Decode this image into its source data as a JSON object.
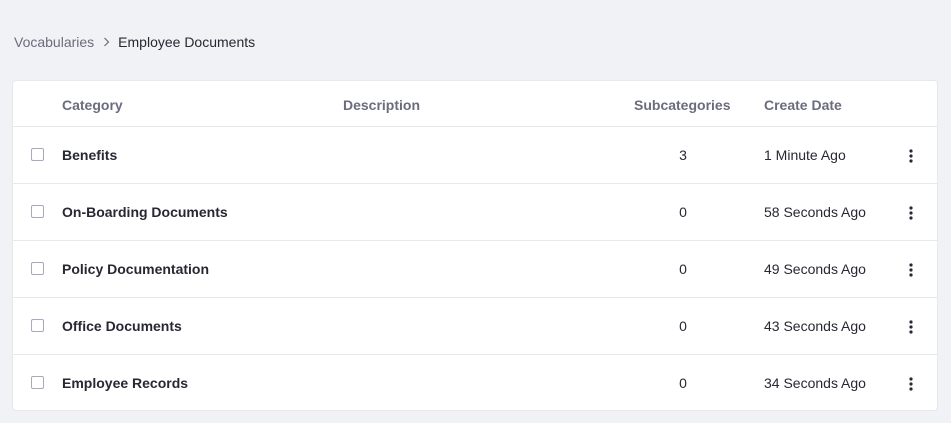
{
  "breadcrumb": {
    "parent": "Vocabularies",
    "current": "Employee Documents"
  },
  "table": {
    "headers": {
      "category": "Category",
      "description": "Description",
      "subcategories": "Subcategories",
      "create_date": "Create Date"
    },
    "rows": [
      {
        "name": "Benefits",
        "description": "",
        "subcategories": "3",
        "create_date": "1 Minute Ago"
      },
      {
        "name": "On-Boarding Documents",
        "description": "",
        "subcategories": "0",
        "create_date": "58 Seconds Ago"
      },
      {
        "name": "Policy Documentation",
        "description": "",
        "subcategories": "0",
        "create_date": "49 Seconds Ago"
      },
      {
        "name": "Office Documents",
        "description": "",
        "subcategories": "0",
        "create_date": "43 Seconds Ago"
      },
      {
        "name": "Employee Records",
        "description": "",
        "subcategories": "0",
        "create_date": "34 Seconds Ago"
      }
    ]
  },
  "icons": {
    "separator": "chevron-right-icon",
    "row_actions": "ellipsis-vertical-icon"
  },
  "colors": {
    "background": "#f1f2f5",
    "text": "#272833",
    "muted": "#6b6c7e",
    "border": "#e7e7ed"
  }
}
